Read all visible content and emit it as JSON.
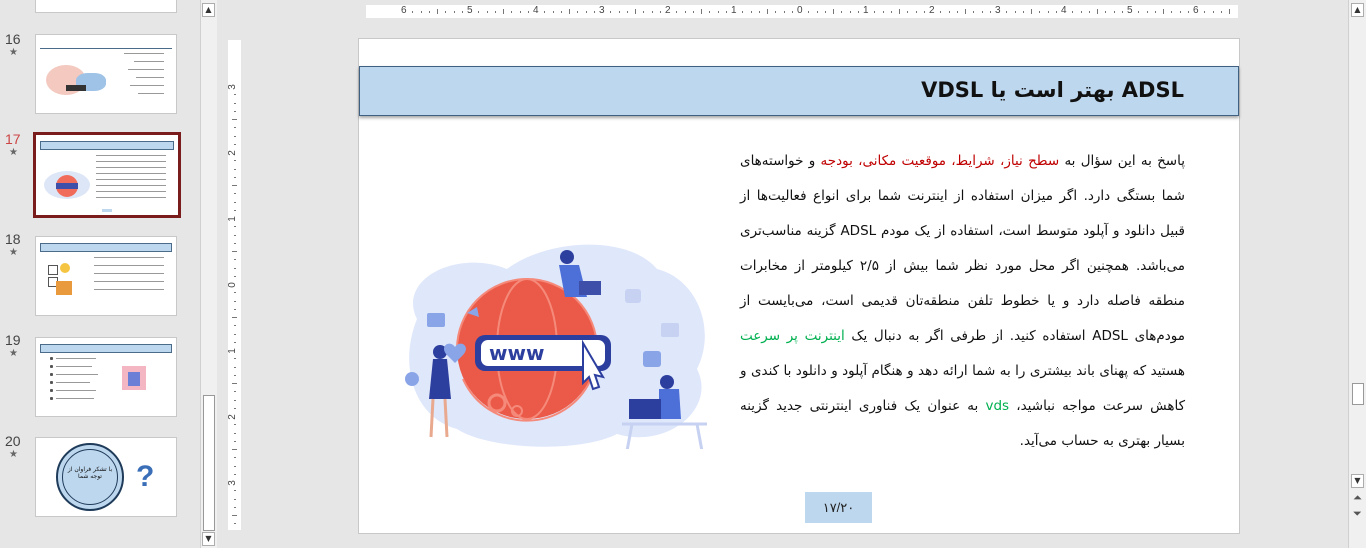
{
  "thumbnails": [
    {
      "num": "16",
      "title": "مزایای مودم ADSL نسبت به VDSL",
      "selected": false
    },
    {
      "num": "17",
      "title": "ADSL بهتر است یا VDSL",
      "selected": true
    },
    {
      "num": "18",
      "title": "نتیجه گیری",
      "selected": false
    },
    {
      "num": "19",
      "title": "منابع",
      "selected": false
    },
    {
      "num": "20",
      "title": "با تشکر فراوان از توجه شما",
      "selected": false
    }
  ],
  "ruler": {
    "horizontal": [
      "6",
      "5",
      "4",
      "3",
      "2",
      "1",
      "0",
      "1",
      "2",
      "3",
      "4",
      "5",
      "6"
    ],
    "vertical": [
      "3",
      "2",
      "1",
      "0",
      "1",
      "2",
      "3"
    ]
  },
  "slide": {
    "title": "ADSL بهتر است یا VDSL",
    "body": {
      "p1_a": "پاسخ به این سؤال به ",
      "p1_red": "سطح نیاز، شرایط، موقعیت مکانی، بودجه",
      "p1_b": " و خواسته‌های شما بستگی دارد. اگر میزان استفاده از اینترنت شما برای انواع فعالیت‌ها از قبیل دانلود و آپلود متوسط است، استفاده از یک مودم ADSL گزینه مناسب‌تری می‌باشد. همچنین اگر محل مورد نظر شما بیش از ۲/۵ کیلومتر از مخابرات منطقه فاصله دارد و یا خطوط تلفن منطقه‌تان قدیمی است، می‌بایست از مودم‌های ADSL استفاده کنید.  از طرفی اگر به دنبال یک ",
      "green1": "اینترنت پر سرعت",
      "p1_c": " هستید که پهنای باند بیشتری را به شما ارائه دهد و هنگام آپلود و دانلود با کندی و کاهش سرعت مواجه نباشید، ",
      "green2": "vds",
      "p1_d": " به عنوان یک فناوری اینترنتی جدید گزینه بسیار بهتری به حساب می‌آید."
    },
    "page_number": "۱۷/۲۰",
    "illustration_text": "www"
  },
  "colors": {
    "title_bar": "#bdd7ee",
    "highlight_red": "#c00000",
    "highlight_green": "#00b050",
    "selected_border": "#7b1c1c"
  }
}
